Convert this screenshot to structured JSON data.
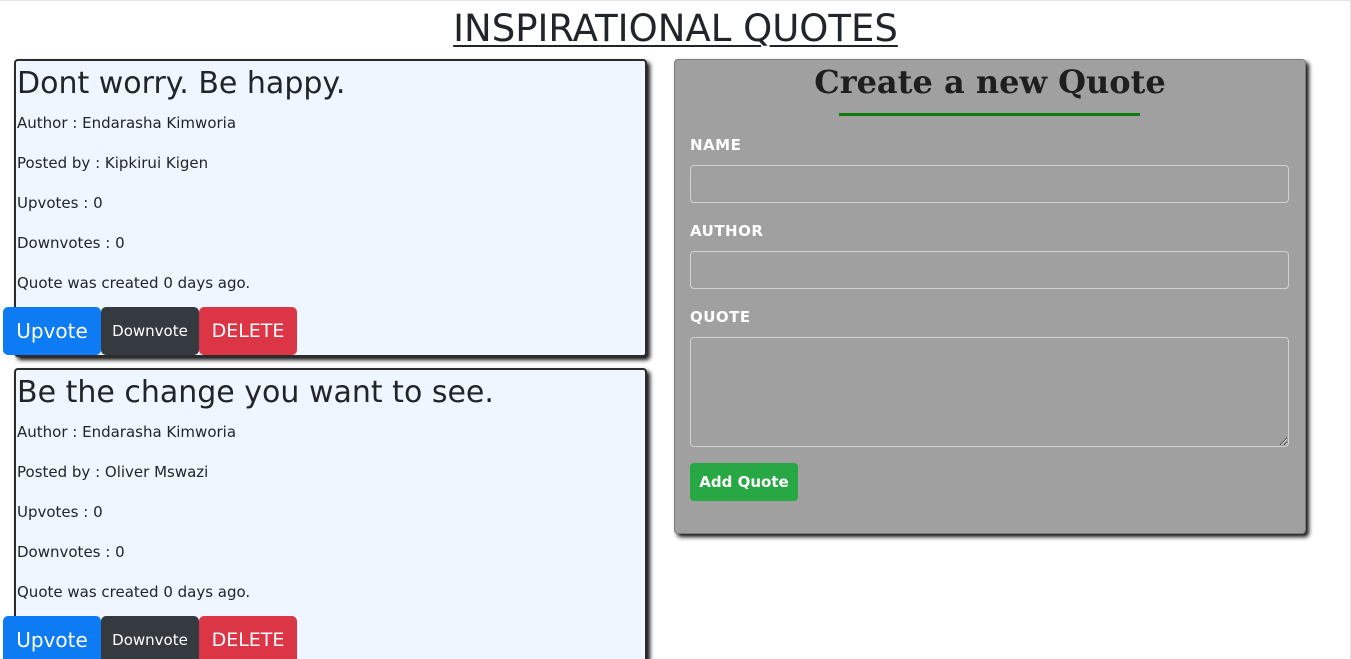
{
  "page": {
    "title": "INSPIRATIONAL QUOTES"
  },
  "quotes": [
    {
      "text": "Dont worry. Be happy.",
      "author_line": "Author : Endarasha Kimworia",
      "posted_line": "Posted by : Kipkirui Kigen",
      "upvotes_line": "Upvotes : 0",
      "downvotes_line": "Downvotes : 0",
      "created_line": "Quote was created 0 days ago.",
      "upvote_label": "Upvote",
      "downvote_label": "Downvote",
      "delete_label": "DELETE"
    },
    {
      "text": "Be the change you want to see.",
      "author_line": "Author : Endarasha Kimworia",
      "posted_line": "Posted by : Oliver Mswazi",
      "upvotes_line": "Upvotes : 0",
      "downvotes_line": "Downvotes : 0",
      "created_line": "Quote was created 0 days ago.",
      "upvote_label": "Upvote",
      "downvote_label": "Downvote",
      "delete_label": "DELETE"
    }
  ],
  "form": {
    "title": "Create a new Quote",
    "name_label": "NAME",
    "name_value": "",
    "author_label": "AUTHOR",
    "author_value": "",
    "quote_label": "QUOTE",
    "quote_value": "",
    "submit_label": "Add Quote"
  },
  "colors": {
    "upvote": "#0d7bf3",
    "downvote": "#343a40",
    "delete": "#dc3545",
    "add": "#28a745",
    "card_bg": "#eff6ff",
    "form_bg": "#a0a0a0",
    "title_rule": "#0e7a0e"
  }
}
